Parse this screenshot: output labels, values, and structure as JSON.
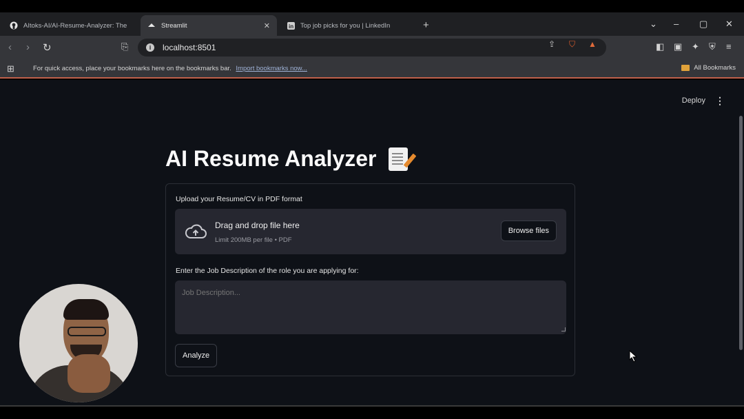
{
  "browser": {
    "tabs": [
      {
        "title": "AItoks-AI/AI-Resume-Analyzer: The",
        "icon": "github-icon",
        "active": false
      },
      {
        "title": "Streamlit",
        "icon": "streamlit-icon",
        "active": true
      },
      {
        "title": "Top job picks for you | LinkedIn",
        "icon": "linkedin-icon",
        "active": false
      }
    ],
    "url": "localhost:8501",
    "bookmarks_hint": "For quick access, place your bookmarks here on the bookmarks bar.",
    "import_bookmarks": "Import bookmarks now...",
    "all_bookmarks": "All Bookmarks"
  },
  "header": {
    "deploy_label": "Deploy",
    "menu_glyph": "⋮"
  },
  "main": {
    "title": "AI Resume Analyzer",
    "upload": {
      "label": "Upload your Resume/CV in PDF format",
      "drop_title": "Drag and drop file here",
      "drop_limit": "Limit 200MB per file • PDF",
      "browse_label": "Browse files"
    },
    "job_description": {
      "label": "Enter the Job Description of the role you are applying for:",
      "placeholder": "Job Description..."
    },
    "analyze_label": "Analyze"
  }
}
